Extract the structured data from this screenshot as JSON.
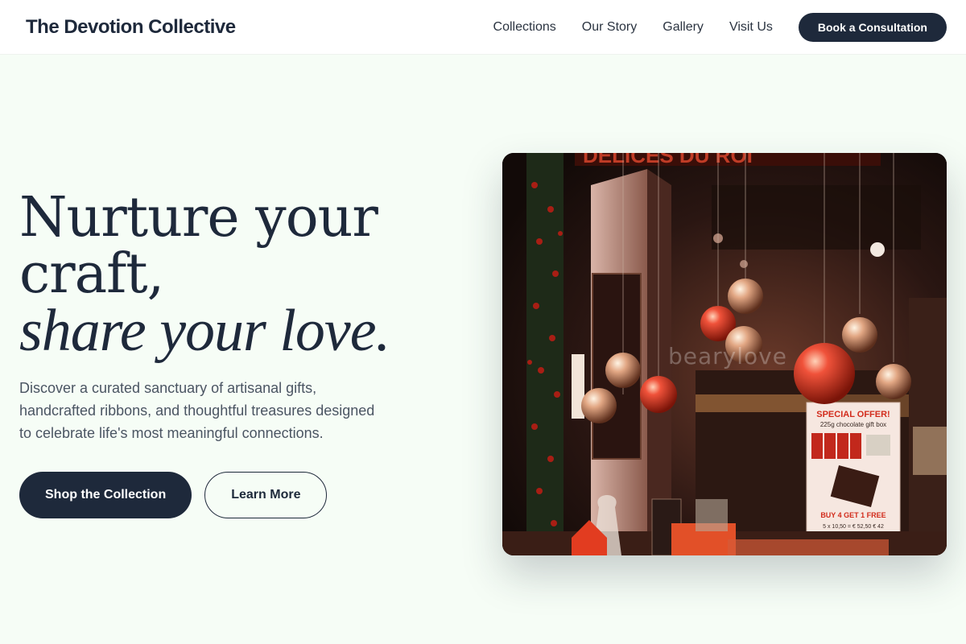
{
  "header": {
    "brand": "The Devotion Collective",
    "nav": [
      "Collections",
      "Our Story",
      "Gallery",
      "Visit Us"
    ],
    "cta_label": "Book a Consultation"
  },
  "hero": {
    "headline_line1": "Nurture your",
    "headline_line2": "craft,",
    "headline_line3": "share your love.",
    "description": "Discover a curated sanctuary of artisanal gifts, handcrafted ribbons, and thoughtful treasures designed to celebrate life's most meaningful connections.",
    "primary_button": "Shop the Collection",
    "secondary_button": "Learn More"
  },
  "image": {
    "watermark": "bearylove",
    "sign_title": "SPECIAL OFFER!",
    "sign_subtitle": "225g chocolate gift box",
    "sign_offer": "BUY 4 GET 1 FREE",
    "sign_price": "5 x 10,50 = € 52,50  € 42"
  },
  "colors": {
    "primary": "#1e293b",
    "background": "#f6fdf6",
    "ornament_red": "#e0412a",
    "ornament_gold": "#e8b98a"
  }
}
